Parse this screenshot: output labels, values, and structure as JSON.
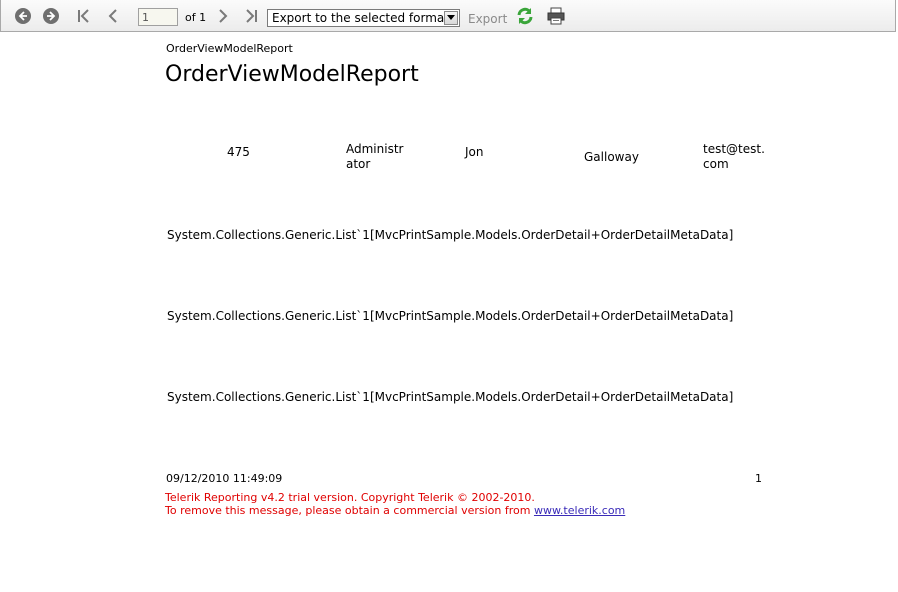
{
  "toolbar": {
    "page_value": "1",
    "of_label": "of 1",
    "export_format": "Export to the selected format",
    "export_label": "Export",
    "icons": [
      "back-icon",
      "forward-icon",
      "first-page-icon",
      "previous-page-icon",
      "next-page-icon",
      "last-page-icon",
      "refresh-icon",
      "print-icon"
    ]
  },
  "report": {
    "small_title": "OrderViewModelReport",
    "title": "OrderViewModelReport",
    "header_row": {
      "id": "475",
      "username_l1": "Administr",
      "username_l2": "ator",
      "first_name": "Jon",
      "last_name": "Galloway",
      "email_l1": "test@test.",
      "email_l2": "com"
    },
    "details": [
      "System.Collections.Generic.List`1[MvcPrintSample.Models.OrderDetail+OrderDetailMetaData]",
      "System.Collections.Generic.List`1[MvcPrintSample.Models.OrderDetail+OrderDetailMetaData]",
      "System.Collections.Generic.List`1[MvcPrintSample.Models.OrderDetail+OrderDetailMetaData]"
    ],
    "footer": {
      "date": "09/12/2010 11:49:09",
      "page": "1"
    },
    "trial": {
      "line1": "Telerik Reporting v4.2 trial version. Copyright Telerik © 2002-2010.",
      "line2": "To remove this message, please obtain a commercial version from",
      "link": "www.telerik.com"
    }
  }
}
